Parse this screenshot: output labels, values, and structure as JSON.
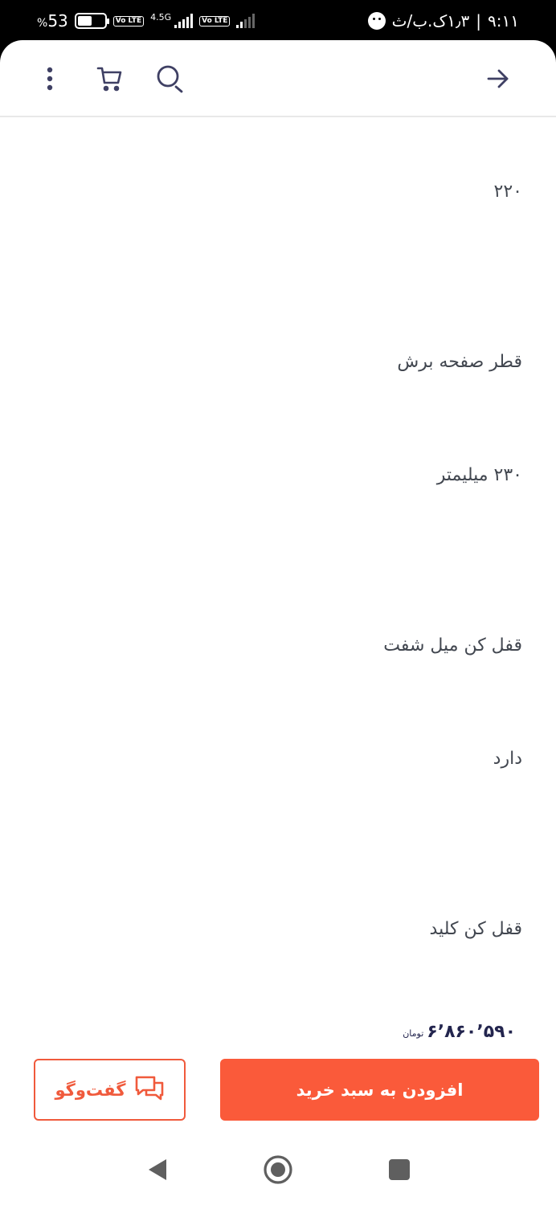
{
  "status_bar": {
    "time": "۹:۱۱",
    "data_speed": "۱٫۳ک.ب/ث",
    "separator": "|",
    "battery": "53",
    "battery_suffix": "%",
    "battery_level": 0.53,
    "network": "4.5G",
    "volte_label": "Vo LTE",
    "icons": [
      "face-icon",
      "volte-icon",
      "signal-icon",
      "battery-icon"
    ]
  },
  "toolbar": {
    "back_icon": "arrow-right-icon",
    "search_icon": "search-icon",
    "cart_icon": "cart-icon",
    "more_icon": "more-vertical-icon"
  },
  "specs": [
    {
      "text": "۲۲۰"
    },
    {
      "text": "قطر صفحه برش"
    },
    {
      "text": "۲۳۰ میلیمتر"
    },
    {
      "text": "قفل کن میل شفت"
    },
    {
      "text": "دارد"
    },
    {
      "text": "قفل کن کلید"
    }
  ],
  "purchase": {
    "price": "۶٬۸۶۰٬۵۹۰",
    "currency": "تومان",
    "add_to_cart_label": "افزودن به سبد خرید",
    "chat_label": "گفت‌وگو",
    "chat_icon": "chat-icon"
  },
  "colors": {
    "accent": "#fa5a3a",
    "text": "#424750",
    "price": "#23254e"
  },
  "navigation": {
    "back_icon": "triangle-back-icon",
    "home_icon": "circle-home-icon",
    "recents_icon": "square-recents-icon"
  }
}
